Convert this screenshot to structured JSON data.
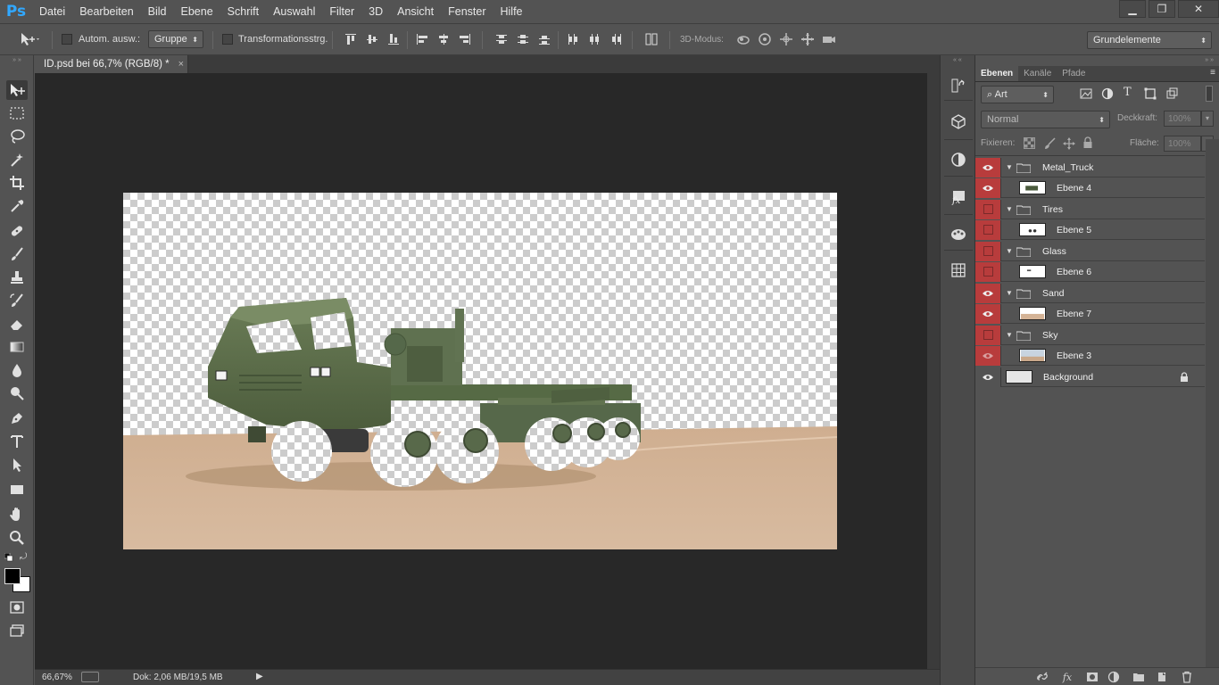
{
  "app": {
    "logo": "Ps"
  },
  "menu": [
    "Datei",
    "Bearbeiten",
    "Bild",
    "Ebene",
    "Schrift",
    "Auswahl",
    "Filter",
    "3D",
    "Ansicht",
    "Fenster",
    "Hilfe"
  ],
  "window_buttons": {
    "minimize": "▁",
    "restore": "❐",
    "close": "✕"
  },
  "options": {
    "auto_select_label": "Autom. ausw.:",
    "auto_select_mode": "Gruppe",
    "transform_label": "Transformationsstrg.",
    "mode_3d_label": "3D-Modus:",
    "workspace": "Grundelemente"
  },
  "document": {
    "tab_title": "ID.psd bei 66,7% (RGB/8) *",
    "tab_close": "×",
    "zoom": "66,67%",
    "doc_info": "Dok: 2,06 MB/19,5 MB"
  },
  "panel": {
    "tabs": [
      "Ebenen",
      "Kanäle",
      "Pfade"
    ],
    "filter_kind": "Art",
    "blend_mode": "Normal",
    "opacity_label": "Deckkraft:",
    "opacity_value": "100%",
    "lock_label": "Fixieren:",
    "fill_label": "Fläche:",
    "fill_value": "100%"
  },
  "layers": [
    {
      "name": "Metal_Truck",
      "type": "group",
      "visible": true
    },
    {
      "name": "Ebene 4",
      "type": "layer",
      "visible": true
    },
    {
      "name": "Tires",
      "type": "group",
      "visible": false
    },
    {
      "name": "Ebene 5",
      "type": "layer",
      "visible": false
    },
    {
      "name": "Glass",
      "type": "group",
      "visible": false
    },
    {
      "name": "Ebene 6",
      "type": "layer",
      "visible": false
    },
    {
      "name": "Sand",
      "type": "group",
      "visible": true
    },
    {
      "name": "Ebene 7",
      "type": "layer",
      "visible": true
    },
    {
      "name": "Sky",
      "type": "group",
      "visible": false
    },
    {
      "name": "Ebene 3",
      "type": "layer",
      "visible": true
    },
    {
      "name": "Background",
      "type": "background",
      "visible": true
    }
  ],
  "colors": {
    "chrome": "#535353",
    "workspace_bg": "#282828",
    "visibility_red": "#b83c3c",
    "truck_green": "#5c6e4a",
    "sand": "#d4b396"
  },
  "icons": {
    "move": "move-tool-icon",
    "marquee": "marquee-tool-icon",
    "lasso": "lasso-tool-icon",
    "wand": "magic-wand-icon",
    "crop": "crop-tool-icon",
    "eyedropper": "eyedropper-icon",
    "heal": "healing-brush-icon",
    "brush": "brush-tool-icon",
    "stamp": "clone-stamp-icon",
    "history": "history-brush-icon",
    "eraser": "eraser-icon",
    "gradient": "gradient-tool-icon",
    "blur": "blur-tool-icon",
    "dodge": "dodge-tool-icon",
    "pen": "pen-tool-icon",
    "type": "type-tool-icon",
    "path_select": "path-selection-icon",
    "shape": "rectangle-tool-icon",
    "hand": "hand-tool-icon",
    "zoom": "zoom-tool-icon"
  }
}
